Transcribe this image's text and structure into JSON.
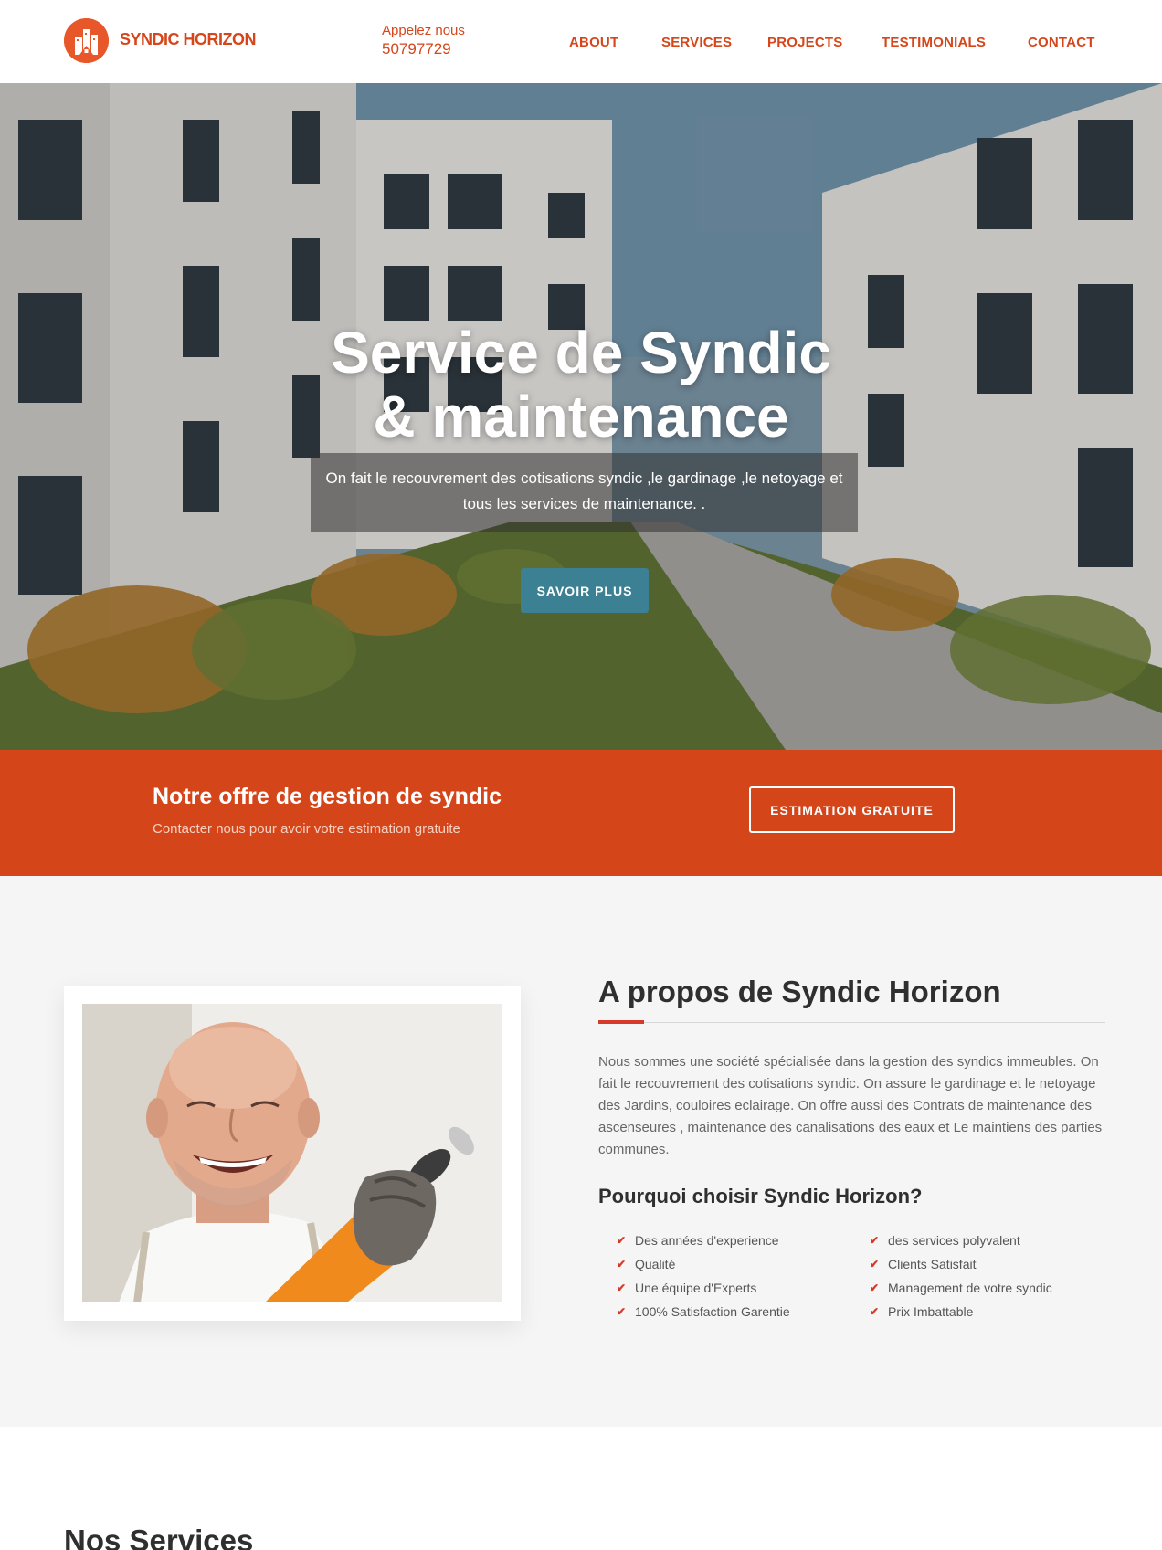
{
  "header": {
    "brand": "SYNDIC HORIZON",
    "call_label": "Appelez nous",
    "call_number": "50797729",
    "nav": [
      "ABOUT",
      "SERVICES",
      "PROJECTS",
      "TESTIMONIALS",
      "CONTACT"
    ]
  },
  "hero": {
    "title_line1": "Service de Syndic",
    "title_line2": "& maintenance",
    "subtitle": "On fait le recouvrement des cotisations syndic ,le gardinage ,le netoyage et tous les services de maintenance. .",
    "button": "SAVOIR PLUS"
  },
  "band": {
    "title": "Notre offre de gestion de syndic",
    "subtitle": "Contacter nous pour avoir votre estimation gratuite",
    "button": "ESTIMATION GRATUITE"
  },
  "about": {
    "title": "A propos de Syndic Horizon",
    "text": "Nous sommes une société spécialisée dans la gestion des syndics immeubles. On fait le recouvrement des cotisations syndic. On assure le gardinage et le netoyage des Jardins, couloires eclairage. On offre aussi des Contrats de maintenance des ascenseures , maintenance des canalisations des eaux et Le maintiens des parties communes.",
    "why_title": "Pourquoi choisir Syndic Horizon?",
    "list_left": [
      "Des années d'experience",
      "Qualité",
      "Une équipe d'Experts",
      "100% Satisfaction Garentie"
    ],
    "list_right": [
      "des services polyvalent",
      "Clients Satisfait",
      "Management de votre syndic",
      "Prix Imbattable"
    ]
  },
  "services": {
    "title": "Nos Services"
  },
  "colors": {
    "brand_orange": "#d4461a",
    "button_teal": "#3b8093",
    "accent_red": "#d63a2a"
  },
  "icons": {
    "logo": "house-logo-icon",
    "check": "check-icon"
  }
}
